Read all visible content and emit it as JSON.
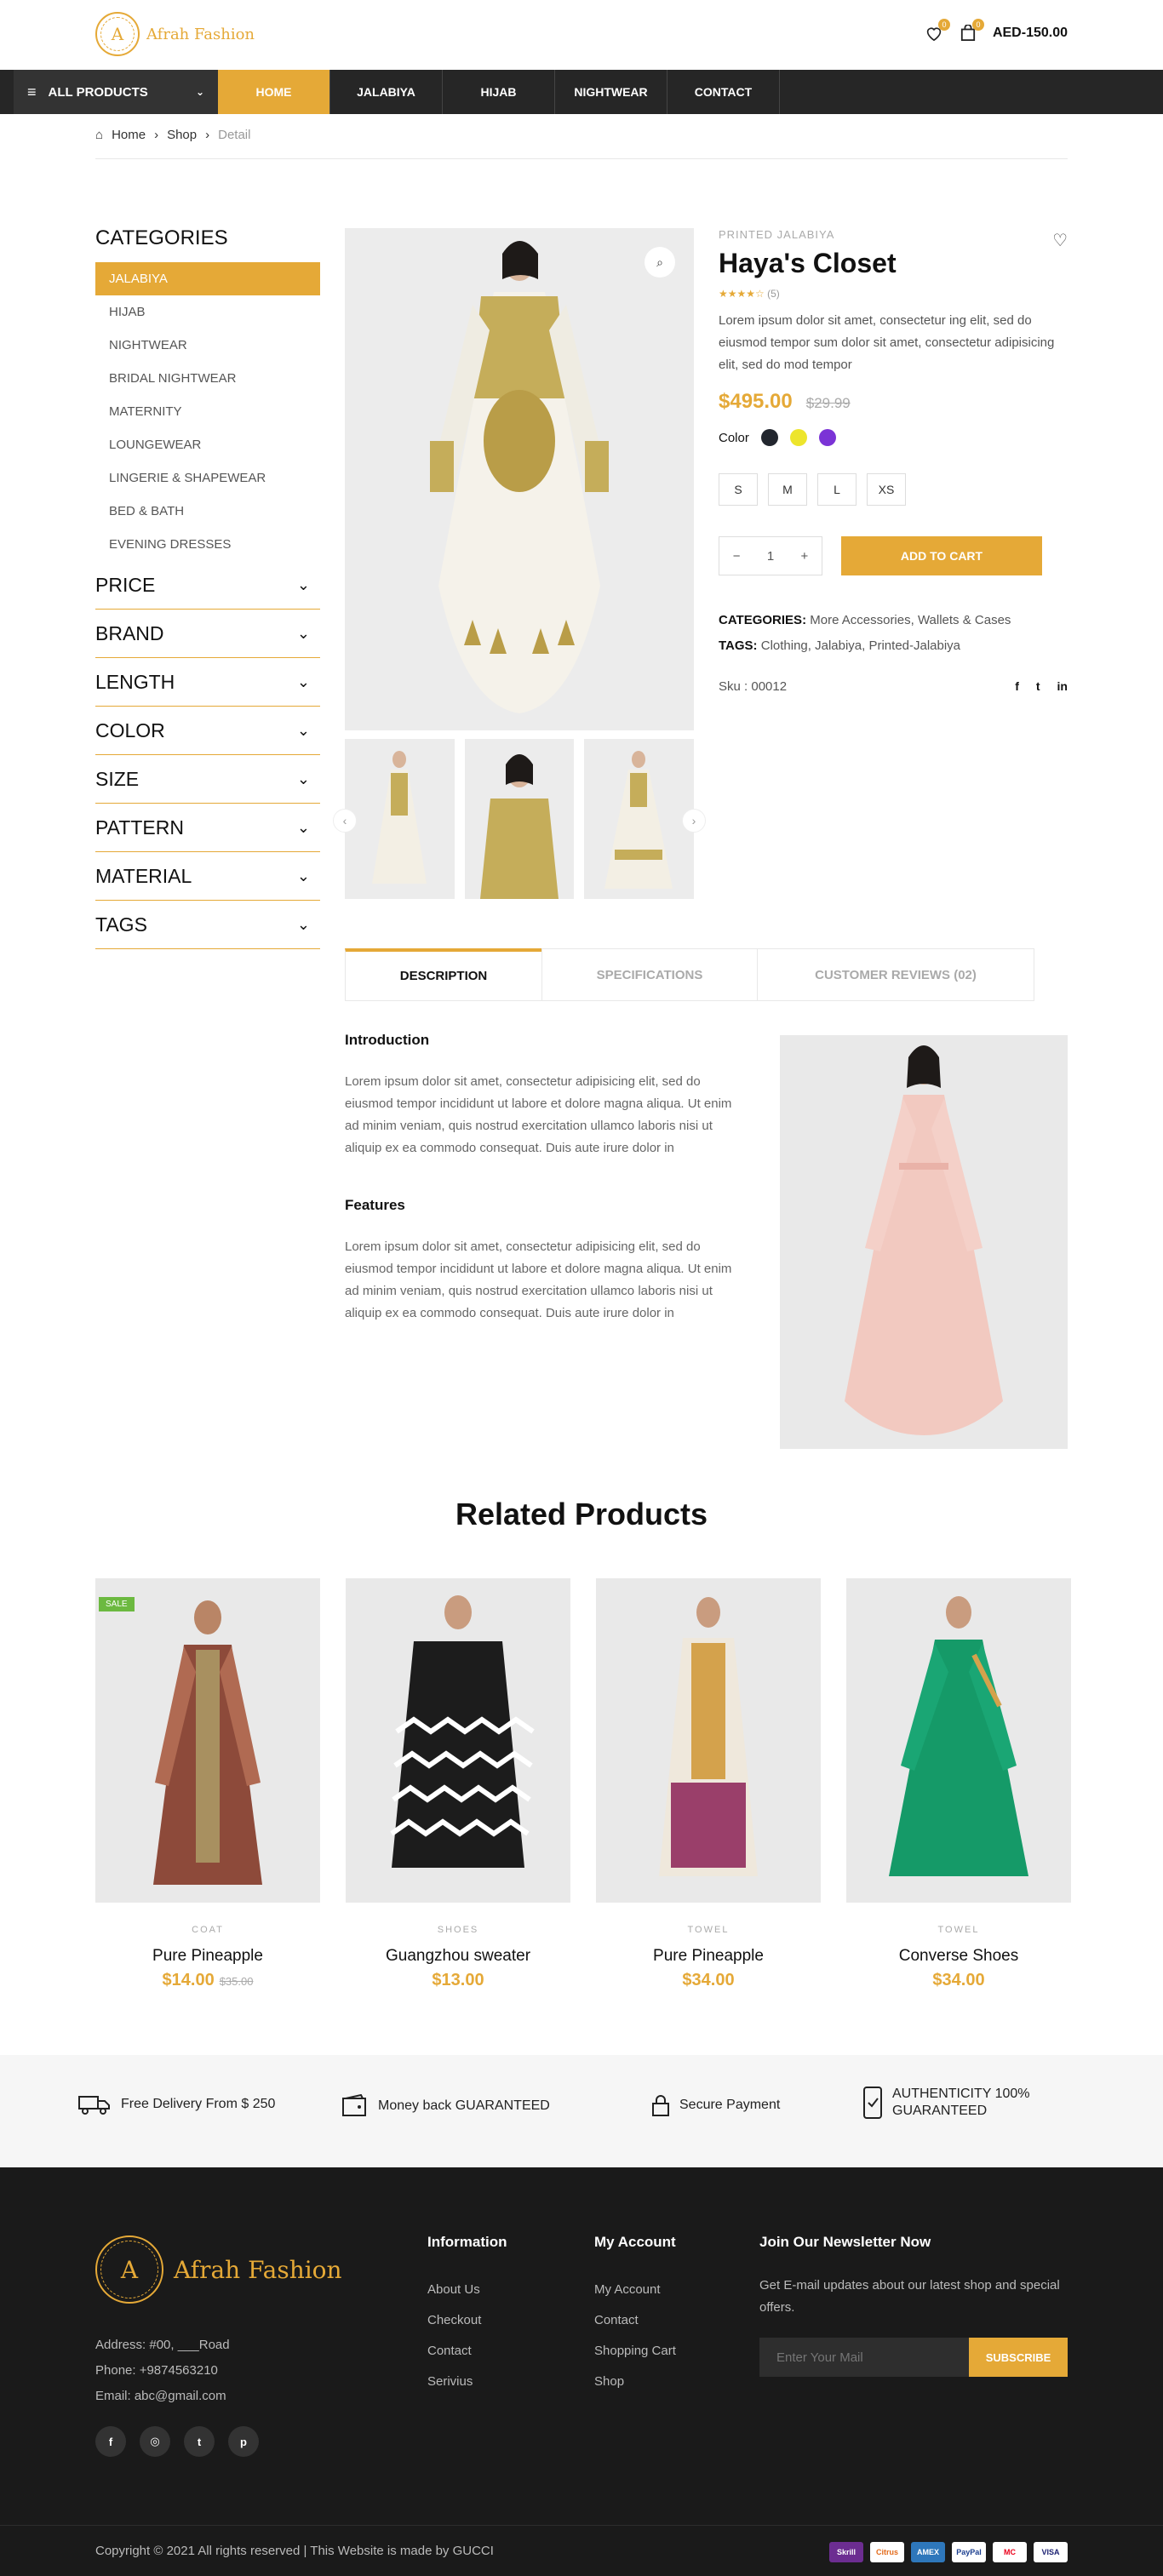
{
  "brand": {
    "name": "Afrah Fashion",
    "mark": "A"
  },
  "header": {
    "wishlist_count": "0",
    "cart_count": "0",
    "cart_total": "AED-150.00"
  },
  "nav": {
    "all_products": "ALL PRODUCTS",
    "items": [
      "HOME",
      "JALABIYA",
      "HIJAB",
      "NIGHTWEAR",
      "CONTACT"
    ]
  },
  "breadcrumb": {
    "home": "Home",
    "shop": "Shop",
    "current": "Detail"
  },
  "sidebar": {
    "categories_title": "CATEGORIES",
    "categories": [
      "JALABIYA",
      "HIJAB",
      "NIGHTWEAR",
      "BRIDAL NIGHTWEAR",
      "MATERNITY",
      "LOUNGEWEAR",
      "LINGERIE & SHAPEWEAR",
      "BED & BATH",
      "EVENING DRESSES"
    ],
    "filters": [
      "PRICE",
      "BRAND",
      "LENGTH",
      "COLOR",
      "SIZE",
      "PATTERN",
      "MATERIAL",
      "TAGS"
    ]
  },
  "product": {
    "category": "PRINTED JALABIYA",
    "title": "Haya's Closet",
    "rating_count": "(5)",
    "description": "Lorem ipsum dolor sit amet, consectetur ing elit, sed do eiusmod tempor sum dolor sit amet, consectetur adipisicing elit, sed do mod tempor",
    "price": "$495.00",
    "old_price": "$29.99",
    "color_label": "Color",
    "colors": [
      "#22262e",
      "#ede52c",
      "#7b33d6"
    ],
    "sizes": [
      "S",
      "M",
      "L",
      "XS"
    ],
    "quantity": "1",
    "add_to_cart": "ADD TO CART",
    "categories_label": "CATEGORIES:",
    "categories_value": "More Accessories, Wallets & Cases",
    "tags_label": "TAGS:",
    "tags_value": "Clothing, Jalabiya, Printed-Jalabiya",
    "sku": "Sku : 00012",
    "share": [
      "f",
      "t",
      "in"
    ]
  },
  "tabs": [
    "DESCRIPTION",
    "SPECIFICATIONS",
    "CUSTOMER REVIEWS (02)"
  ],
  "description": {
    "intro_title": "Introduction",
    "intro_text": "Lorem ipsum dolor sit amet, consectetur adipisicing elit, sed do eiusmod tempor incididunt ut labore et dolore magna aliqua. Ut enim ad minim veniam, quis nostrud exercitation ullamco laboris nisi ut aliquip ex ea commodo consequat. Duis aute irure dolor in",
    "features_title": "Features",
    "features_text": "Lorem ipsum dolor sit amet, consectetur adipisicing elit, sed do eiusmod tempor incididunt ut labore et dolore magna aliqua. Ut enim ad minim veniam, quis nostrud exercitation ullamco laboris nisi ut aliquip ex ea commodo consequat. Duis aute irure dolor in"
  },
  "related": {
    "title": "Related Products",
    "sale_label": "SALE",
    "items": [
      {
        "category": "COAT",
        "name": "Pure Pineapple",
        "price": "$14.00",
        "old_price": "$35.00"
      },
      {
        "category": "SHOES",
        "name": "Guangzhou sweater",
        "price": "$13.00",
        "old_price": ""
      },
      {
        "category": "TOWEL",
        "name": "Pure Pineapple",
        "price": "$34.00",
        "old_price": ""
      },
      {
        "category": "TOWEL",
        "name": "Converse Shoes",
        "price": "$34.00",
        "old_price": ""
      }
    ]
  },
  "features": [
    "Free Delivery From $ 250",
    "Money back GUARANTEED",
    "Secure Payment",
    "AUTHENTICITY 100% GUARANTEED"
  ],
  "footer": {
    "address": "Address: #00, ___Road",
    "phone": "Phone: +9874563210",
    "email": "Email: abc@gmail.com",
    "info_title": "Information",
    "info_links": [
      "About Us",
      "Checkout",
      "Contact",
      "Serivius"
    ],
    "account_title": "My Account",
    "account_links": [
      "My Account",
      "Contact",
      "Shopping Cart",
      "Shop"
    ],
    "news_title": "Join Our Newsletter Now",
    "news_text": "Get E-mail updates about our latest shop and special offers.",
    "news_placeholder": "Enter Your Mail",
    "subscribe": "SUBSCRIBE",
    "copyright": "Copyright © 2021 All rights reserved | This Website is made by GUCCI",
    "payments": [
      "Skrill",
      "Citrus",
      "AMEX",
      "PayPal",
      "MC",
      "VISA"
    ]
  },
  "accent_color": "#e5a937"
}
